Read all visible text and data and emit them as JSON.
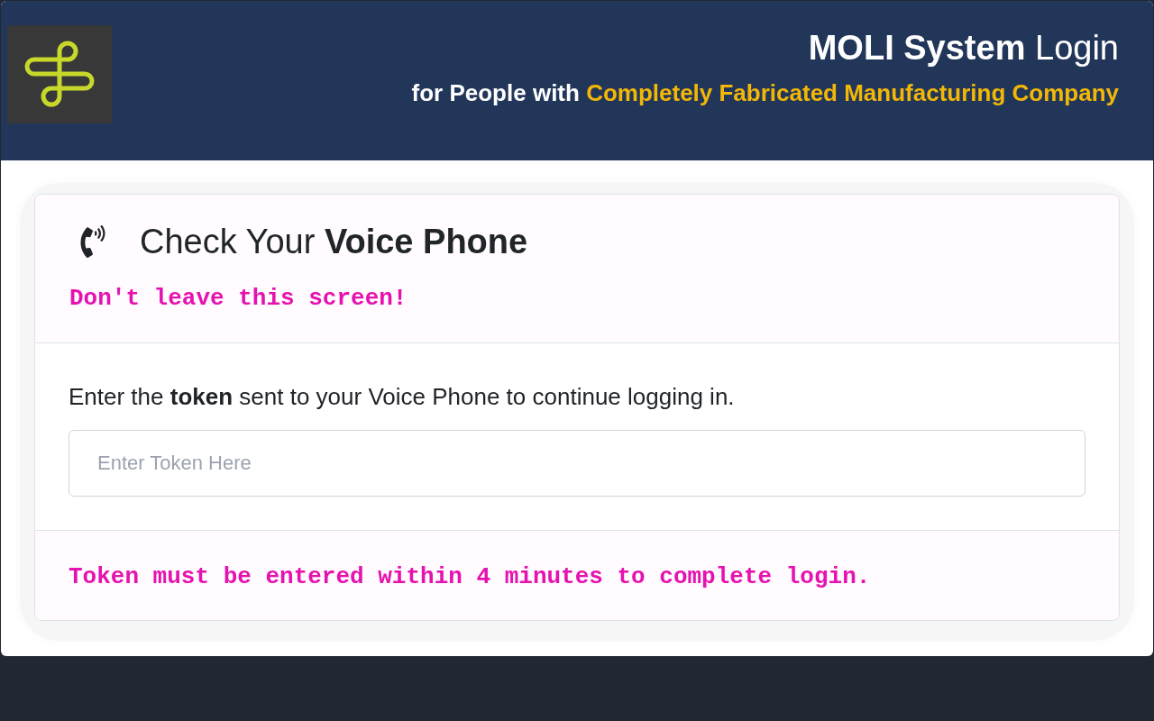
{
  "header": {
    "title": "**MOLI System** Login",
    "subtitle": {
      "text": "for People with",
      "highlight": "Completely Fabricated Manufacturing Company"
    }
  },
  "card": {
    "heading": "Check Your **Voice Phone**",
    "warning": "Don't leave this screen!",
    "instruction": "Enter the **token** sent to your Voice Phone to continue logging in.",
    "token_field": {
      "placeholder": "Enter Token Here"
    },
    "footer_note": "Token must be entered within 4 minutes to complete login."
  }
}
